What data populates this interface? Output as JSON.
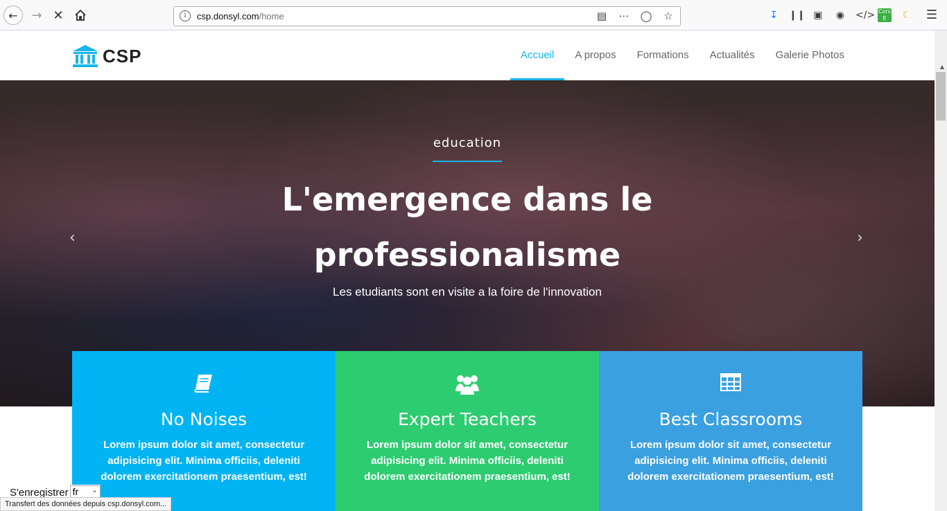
{
  "browser": {
    "url_domain": "csp.donsyl.com",
    "url_path": "/home"
  },
  "site": {
    "logo_text": "CSP",
    "nav": [
      "Accueil",
      "A propos",
      "Formations",
      "Actualités",
      "Galerie Photos"
    ]
  },
  "hero": {
    "tag": "education",
    "title": "L'emergence dans le professionalisme",
    "subtitle": "Les etudiants sont en visite a la foire de l'innovation"
  },
  "features": [
    {
      "icon": "book-icon",
      "title": "No Noises",
      "text": "Lorem ipsum dolor sit amet, consectetur adipisicing elit. Minima officiis, deleniti dolorem exercitationem praesentium, est!",
      "color": "#00b4f3"
    },
    {
      "icon": "users-icon",
      "title": "Expert Teachers",
      "text": "Lorem ipsum dolor sit amet, consectetur adipisicing elit. Minima officiis, deleniti dolorem exercitationem praesentium, est!",
      "color": "#2ecc71"
    },
    {
      "icon": "grid-icon",
      "title": "Best Classrooms",
      "text": "Lorem ipsum dolor sit amet, consectetur adipisicing elit. Minima officiis, deleniti dolorem exercitationem praesentium, est!",
      "color": "#3ba0e0"
    }
  ],
  "footer": {
    "register_label": "S'enregistrer",
    "language_value": "fr",
    "status_text": "Transfert des données depuis csp.donsyl.com..."
  },
  "colors": {
    "accent": "#1ab5ea"
  }
}
